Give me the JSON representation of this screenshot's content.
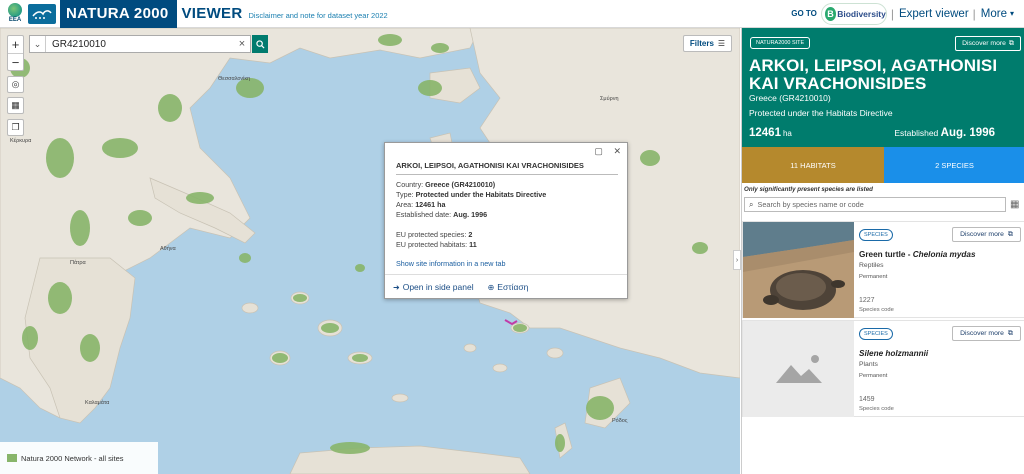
{
  "header": {
    "eea_label": "EEA",
    "brand": "NATURA 2000",
    "viewer": "VIEWER",
    "disclaimer": "Disclaimer and note for dataset year 2022",
    "goto": "GO TO",
    "biodiversity": "Biodiversity",
    "expert_viewer": "Expert viewer",
    "more": "More"
  },
  "search": {
    "value": "GR4210010"
  },
  "filters": {
    "label": "Filters"
  },
  "map_labels": [
    "Θεσσαλονίκη",
    "Αθήνα",
    "Κέρκυρα",
    "Πάτρα",
    "Καλαμάτα",
    "Σμύρνη",
    "Ρόδος"
  ],
  "popup": {
    "title": "ARKOI, LEIPSOI, AGATHONISI KAI VRACHONISIDES",
    "country_label": "Country:",
    "country": "Greece (GR4210010)",
    "type_label": "Type:",
    "type": "Protected under the Habitats Directive",
    "area_label": "Area:",
    "area": "12461 ha",
    "date_label": "Established date:",
    "date": "Aug. 1996",
    "species_label": "EU protected species:",
    "species": "2",
    "habitats_label": "EU protected habitats:",
    "habitats": "11",
    "new_tab": "Show site information in a new tab",
    "open_side": "Open in side panel",
    "zoom_to": "Εστίαση"
  },
  "legend": {
    "label": "Natura 2000 Network - all sites",
    "color": "#88b56a"
  },
  "panel": {
    "badge": "NATURA2000 SITE",
    "discover": "Discover more",
    "site_name": "ARKOI, LEIPSOI, AGATHONISI KAI VRACHONISIDES",
    "country": "Greece (GR4210010)",
    "protection": "Protected under the Habitats Directive",
    "area": "12461",
    "area_unit": "ha",
    "established_label": "Established",
    "established": "Aug. 1996",
    "tab_habitats": "11 HABITATS",
    "tab_species": "2 SPECIES",
    "note": "Only significantly present species are listed",
    "search_placeholder": "Search by species name or code",
    "accent": "#007c6d",
    "habitats_color": "#b5892d",
    "species_color": "#1a8fe9"
  },
  "species": [
    {
      "badge": "SPECIES",
      "discover": "Discover more",
      "common": "Green turtle",
      "sep": " - ",
      "scientific": "Chelonia mydas",
      "group": "Reptiles",
      "status": "Permanent",
      "code": "1227",
      "code_label": "Species code"
    },
    {
      "badge": "SPECIES",
      "discover": "Discover more",
      "common": "",
      "sep": "",
      "scientific": "Silene holzmannii",
      "group": "Plants",
      "status": "Permanent",
      "code": "1459",
      "code_label": "Species code"
    }
  ]
}
